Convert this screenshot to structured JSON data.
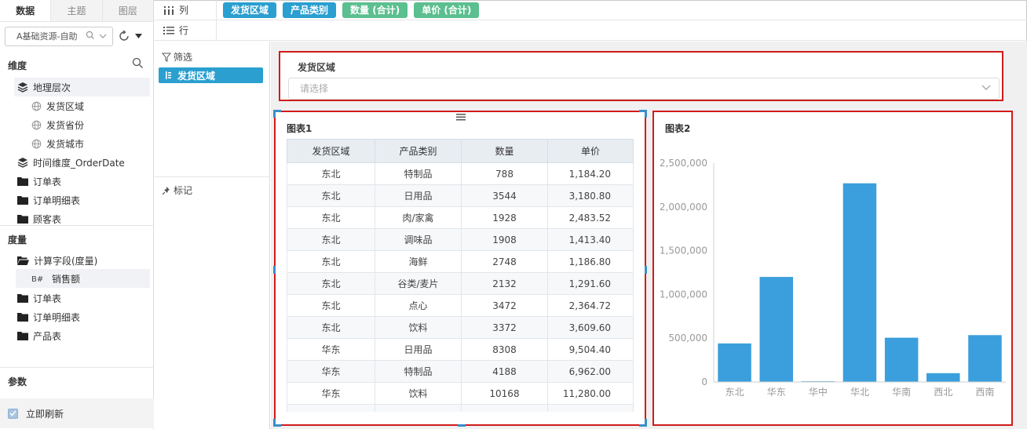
{
  "left_panel": {
    "tabs": [
      {
        "label": "数据"
      },
      {
        "label": "主题"
      },
      {
        "label": "图层"
      }
    ],
    "datasource": {
      "value": "A基础资源-自助"
    },
    "dimension_title": "维度",
    "dimensions": [
      {
        "label": "地理层次",
        "icon": "layers-icon"
      },
      {
        "label": "发货区域",
        "icon": "globe-icon"
      },
      {
        "label": "发货省份",
        "icon": "globe-icon"
      },
      {
        "label": "发货城市",
        "icon": "globe-icon"
      },
      {
        "label": "时间维度_OrderDate",
        "icon": "layers-icon"
      },
      {
        "label": "订单表",
        "icon": "folder-icon"
      },
      {
        "label": "订单明细表",
        "icon": "folder-icon"
      },
      {
        "label": "顾客表",
        "icon": "folder-icon"
      }
    ],
    "measure_title": "度量",
    "measures": [
      {
        "label": "计算字段(度量)",
        "icon": "folder-open-icon"
      },
      {
        "label": "销售额",
        "icon": "hash-icon"
      },
      {
        "label": "订单表",
        "icon": "folder-icon"
      },
      {
        "label": "订单明细表",
        "icon": "folder-icon"
      },
      {
        "label": "产品表",
        "icon": "folder-icon"
      }
    ],
    "param_title": "参数",
    "auto_refresh_label": "立即刷新"
  },
  "shelves": {
    "column_label": "列",
    "row_label": "行",
    "column_pills": [
      {
        "label": "发货区域",
        "kind": "dimension"
      },
      {
        "label": "产品类别",
        "kind": "dimension"
      },
      {
        "label": "数量 (合计)",
        "kind": "measure"
      },
      {
        "label": "单价 (合计)",
        "kind": "measure"
      }
    ]
  },
  "mid_panel": {
    "filter_label": "筛选",
    "filter_pill": "发货区域",
    "marks_label": "标记"
  },
  "filter_widget": {
    "title": "发货区域",
    "placeholder": "请选择"
  },
  "table_widget": {
    "title": "图表1",
    "headers": [
      "发货区域",
      "产品类别",
      "数量",
      "单价"
    ],
    "rows": [
      [
        "东北",
        "特制品",
        "788",
        "1,184.20"
      ],
      [
        "东北",
        "日用品",
        "3544",
        "3,180.80"
      ],
      [
        "东北",
        "肉/家禽",
        "1928",
        "2,483.52"
      ],
      [
        "东北",
        "调味品",
        "1908",
        "1,413.40"
      ],
      [
        "东北",
        "海鲜",
        "2748",
        "1,186.80"
      ],
      [
        "东北",
        "谷类/麦片",
        "2132",
        "1,291.60"
      ],
      [
        "东北",
        "点心",
        "3472",
        "2,364.72"
      ],
      [
        "东北",
        "饮料",
        "3372",
        "3,609.60"
      ],
      [
        "华东",
        "日用品",
        "8308",
        "9,504.40"
      ],
      [
        "华东",
        "特制品",
        "4188",
        "6,962.00"
      ],
      [
        "华东",
        "饮料",
        "10168",
        "11,280.00"
      ]
    ]
  },
  "chart_widget": {
    "title": "图表2"
  },
  "colors": {
    "dimension_pill": "#2a9fd0",
    "measure_pill": "#5bbf8f",
    "bar": "#3a9fdc",
    "highlight_border": "#d11b1b"
  },
  "chart_data": {
    "type": "bar",
    "title": "图表2",
    "categories": [
      "东北",
      "华东",
      "华中",
      "华北",
      "华南",
      "西北",
      "西南"
    ],
    "values": [
      440000,
      1200000,
      8000,
      2270000,
      505000,
      100000,
      535000
    ],
    "ylim": [
      0,
      2500000
    ],
    "yticks": [
      0,
      500000,
      1000000,
      1500000,
      2000000,
      2500000
    ],
    "ytick_labels": [
      "0",
      "500,000",
      "1,000,000",
      "1,500,000",
      "2,000,000",
      "2,500,000"
    ],
    "xlabel": "",
    "ylabel": "",
    "grid": false,
    "legend": "none"
  }
}
